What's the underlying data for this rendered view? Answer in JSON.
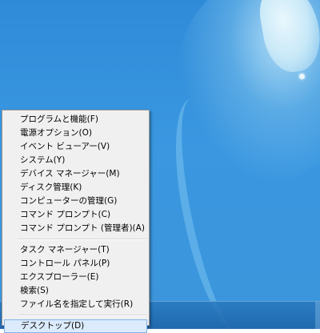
{
  "context_menu": {
    "groups": [
      [
        "プログラムと機能(F)",
        "電源オプション(O)",
        "イベント ビューアー(V)",
        "システム(Y)",
        "デバイス マネージャー(M)",
        "ディスク管理(K)",
        "コンピューターの管理(G)",
        "コマンド プロンプト(C)",
        "コマンド プロンプト (管理者)(A)"
      ],
      [
        "タスク マネージャー(T)",
        "コントロール パネル(P)",
        "エクスプローラー(E)",
        "検索(S)",
        "ファイル名を指定して実行(R)"
      ],
      [
        "デスクトップ(D)"
      ]
    ],
    "selected": "デスクトップ(D)"
  },
  "colors": {
    "desktop": "#3a97e0",
    "menu_bg": "#f0f0f0",
    "selected_bg": "#dcebfc",
    "selected_border": "#7eb4ea"
  }
}
